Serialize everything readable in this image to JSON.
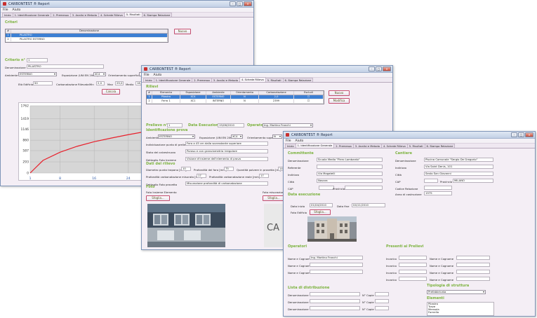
{
  "win1": {
    "title": "CARBONTEST ® Report",
    "menu": [
      "File",
      "Aiuto"
    ],
    "tabs": [
      "Inizio",
      "1. Identificazione Generale",
      "2. Premessa",
      "3. Analisi e Metodo",
      "4. Schede Rilievo",
      "5. Risultati",
      "6. Stampa Relazione"
    ],
    "active_tab": 5,
    "criteri_title": "Criteri",
    "grid_headers": [
      "#",
      "Denominazione"
    ],
    "grid_rows": [
      [
        "1",
        "PILASTRO"
      ],
      [
        "2",
        "PILASTRO ESTERNO"
      ]
    ],
    "nuovo_label": "Nuovo",
    "criterio_title": "Criterio n°",
    "criterio_value": "1",
    "denominazione_label": "Denominazione",
    "denominazione_value": "PILASTRO",
    "ambiente_label": "Ambiente",
    "ambiente_value": "ESTERNO",
    "esposizione_label": "Esposizione (UNI EN 206-1)",
    "esposizione_value": "XC4",
    "orientamento_label": "Orientamento superficie",
    "eta_label": "Età Edificio",
    "eta_value": "50",
    "carbonatazione_label": "Carbonatazione Rilevata",
    "min_label": "Min",
    "min_value": "2,0",
    "max_label": "Max",
    "max_value": "29,0",
    "medio_label": "Medio",
    "medio_value": "16,5",
    "calcola_label": "Calcola",
    "chart_yticks": [
      "1762",
      "1419",
      "1146",
      "860",
      "587",
      "293",
      "0"
    ],
    "chart_xticks": [
      "1",
      "8",
      "16",
      "24",
      "32",
      "40",
      "48"
    ]
  },
  "chart_data": {
    "type": "line",
    "x": [
      1,
      4,
      8,
      12,
      16,
      20,
      24,
      28,
      32,
      36,
      40,
      44,
      48,
      52
    ],
    "y": [
      0,
      330,
      545,
      700,
      820,
      915,
      1005,
      1085,
      1155,
      1225,
      1290,
      1345,
      1400,
      1450
    ],
    "ylim": [
      0,
      1762
    ],
    "xlim": [
      1,
      52
    ],
    "color": "#e8202b",
    "grid": true
  },
  "win2": {
    "title": "CARBONTEST ® Report",
    "menu": [
      "File",
      "Aiuto"
    ],
    "tabs": [
      "Inizio",
      "1. Identificazione Generale",
      "2. Premessa",
      "3. Analisi e Metodo",
      "4. Schede Rilievo",
      "5. Risultati",
      "6. Stampa Relazione"
    ],
    "active_tab": 4,
    "rilievi_title": "Rilievi",
    "grid_headers": [
      "#",
      "Elemento",
      "Esposizione",
      "Ambiente",
      "Orientamento",
      "Carbonatazione",
      "Escludi"
    ],
    "grid_rows": [
      [
        "1",
        "Pilastro",
        "XC4",
        "ESTERNO",
        "N",
        "2,0",
        ""
      ],
      [
        "2",
        "Ferro 1",
        "XC1",
        "INTERNO",
        "N",
        "2399",
        ""
      ]
    ],
    "nuovo_label": "Nuovo",
    "modifica_label": "Modifica",
    "prelievo_title": "Prelievo n°",
    "prelievo_value": "1",
    "data_esecuzione_title": "Data Esecuzione",
    "data_esecuzione_value": "15/06/2010",
    "operatore_title": "Operatore",
    "operatore_value": "Ing. Martino Franchi",
    "identificazione_title": "Identificazione prova",
    "ambiente_label": "Ambiente",
    "ambiente_value": "ESTERNO",
    "esposizione_label": "Esposizione (UNI EN 206-1)",
    "esposizione_value": "XC4",
    "orientamento_label": "Orientamento superficie",
    "orientamento_value": "N",
    "individuazione_label": "Individuazione punto di prelievo",
    "individuazione_value": "Foro a 45 cm dalla sovrastante superiore",
    "stato_label": "Stato del calcestruzzo",
    "stato_value": "Poroso e con granulometria irregolare",
    "descrizione_label": "Dettaglio Foto Insieme",
    "descrizione_value": "Visione d'insieme dell'elemento di prova",
    "dati_title": "Dati del rilievo",
    "diametro_label": "Diametro punta trapano [mm]",
    "diametro_value": "10",
    "profondita_label": "Profondità del foro [mm]",
    "profondita_value": "75",
    "quantita_label": "Quantità polvere in provetta [ml]",
    "quantita_value": "140",
    "prof_carb_label": "Profondità carbonatazione misurata [mm]",
    "prof_carb_value": "17",
    "prof_carb_reale_label": "Profondità carbonatazione reale [mm]",
    "prof_carb_reale_value": "17",
    "dettaglio_provetta_label": "Dettaglio Foto provetta",
    "dettaglio_provetta_value": "Misurazione profondità di carbonatazione",
    "foto_title": "Foto",
    "foto_insieme_label": "Foto Insieme Elemento",
    "foto_provetta_label": "Foto misurazione",
    "sfoglia_label": "Sfoglia..."
  },
  "win3": {
    "title": "CARBONTEST ® Report",
    "menu": [
      "File",
      "Aiuto"
    ],
    "tabs": [
      "Inizio",
      "1. Identificazione Generale",
      "2. Premessa",
      "3. Analisi e Metodo",
      "4. Schede Rilievo",
      "5. Risultati",
      "6. Stampa Relazione"
    ],
    "active_tab": 1,
    "committente_title": "Committente",
    "cantiere_title": "Cantiere",
    "c_denominazione_label": "Denominazione",
    "c_denominazione_value": "Scuola Media \"Piero Lombardo\"",
    "c_referente_label": "Referente",
    "c_indirizzo_label": "Indirizzo",
    "c_indirizzo_value": "Via Magatelli",
    "c_citta_label": "Città",
    "c_citta_value": "Novara",
    "c_cap_label": "CAP",
    "c_provincia_label": "Provincia",
    "k_denominazione_label": "Denominazione",
    "k_denominazione_value": "Piscina Comunale \"Sergio De Gregorio\"",
    "k_indirizzo_label": "Indirizzo",
    "k_indirizzo_value": "Via Saint Denis, 101",
    "k_citta_label": "Città",
    "k_citta_value": "Sesto San Giovanni",
    "k_cap_label": "CAP",
    "k_provincia_label": "Provincia",
    "k_provincia_value": "MILANO",
    "k_codice_label": "Codice Relazione",
    "k_anno_label": "Anno di costruzione",
    "k_anno_value": "1975",
    "data_esecuzione_title": "Data esecuzione",
    "data_inizio_label": "Data inizio",
    "data_inizio_value": "01/04/2010",
    "data_fine_label": "Data fine",
    "data_fine_value": "04/11/2010",
    "foto_edificio_label": "Foto Edificio",
    "sfoglia_label": "Sfoglia...",
    "operatori_title": "Operatori",
    "presenti_title": "Presenti ai Prelievi",
    "nome_cognome_label": "Nome e Cognome",
    "operatore1": "Ing. Martino Franchi",
    "incarico_label": "Incarico",
    "distribuzione_title": "Lista di distribuzione",
    "denominazione_label": "Denominazione",
    "ncopie_label": "N° Copie",
    "tipologia_title": "Tipologia di struttura",
    "tipologia_value": "Prefabbricata",
    "elementi_title": "Elementi",
    "elementi_items": [
      "Pilastro",
      "Trave",
      "Mensola",
      "Fornello"
    ]
  }
}
